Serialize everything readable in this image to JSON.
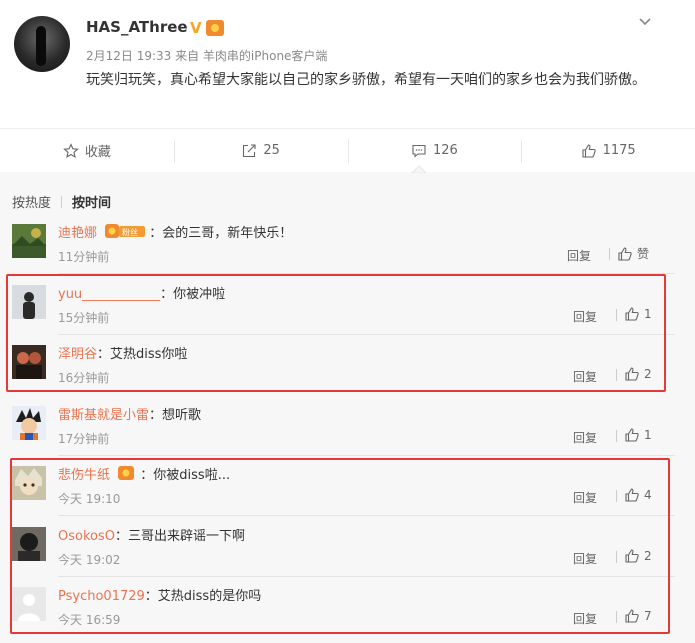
{
  "post": {
    "username": "HAS_AThree",
    "verified_mark": "V",
    "meta": "2月12日 19:33 来自 羊肉串的iPhone客户端",
    "text": "玩笑归玩笑，真心希望大家能以自己的家乡骄傲，希望有一天咱们的家乡也会为我们骄傲。"
  },
  "actions": {
    "favorite_label": "收藏",
    "repost_count": "25",
    "comment_count": "126",
    "like_count": "1175"
  },
  "sort": {
    "hot_label": "按热度",
    "time_label": "按时间"
  },
  "comments": [
    {
      "user": "迪艳娜",
      "text": "：会的三哥，新年快乐！",
      "time": "11分钟前",
      "reply": "回复",
      "like": "赞",
      "badge": "粉丝",
      "avatar_icon": "landscape-avatar-icon"
    },
    {
      "user": "yuu____________",
      "text": "：你被冲啦",
      "time": "15分钟前",
      "reply": "回复",
      "like": "1",
      "avatar_icon": "person-avatar-icon"
    },
    {
      "user": "泽明谷",
      "text": "：艾热diss你啦",
      "time": "16分钟前",
      "reply": "回复",
      "like": "2",
      "avatar_icon": "group-avatar-icon"
    },
    {
      "user": "雷斯基就是小雷",
      "text": "：想听歌",
      "time": "17分钟前",
      "reply": "回复",
      "like": "1",
      "avatar_icon": "anime-avatar-icon"
    },
    {
      "user": "悲伤牛纸",
      "text": "：你被diss啦...",
      "time": "今天 19:10",
      "reply": "回复",
      "like": "4",
      "avatar_icon": "anime-face-avatar-icon"
    },
    {
      "user": "OsokosO",
      "text": "：三哥出来辟谣一下啊",
      "time": "今天 19:02",
      "reply": "回复",
      "like": "2",
      "avatar_icon": "dark-avatar-icon"
    },
    {
      "user": "Psycho01729",
      "text": "：艾热diss的是你吗",
      "time": "今天 16:59",
      "reply": "回复",
      "like": "7",
      "avatar_icon": "default-avatar-icon"
    }
  ],
  "colors": {
    "username_link": "#eb7350",
    "highlight_box": "#e53935",
    "badge_orange": "#f18a2e"
  }
}
